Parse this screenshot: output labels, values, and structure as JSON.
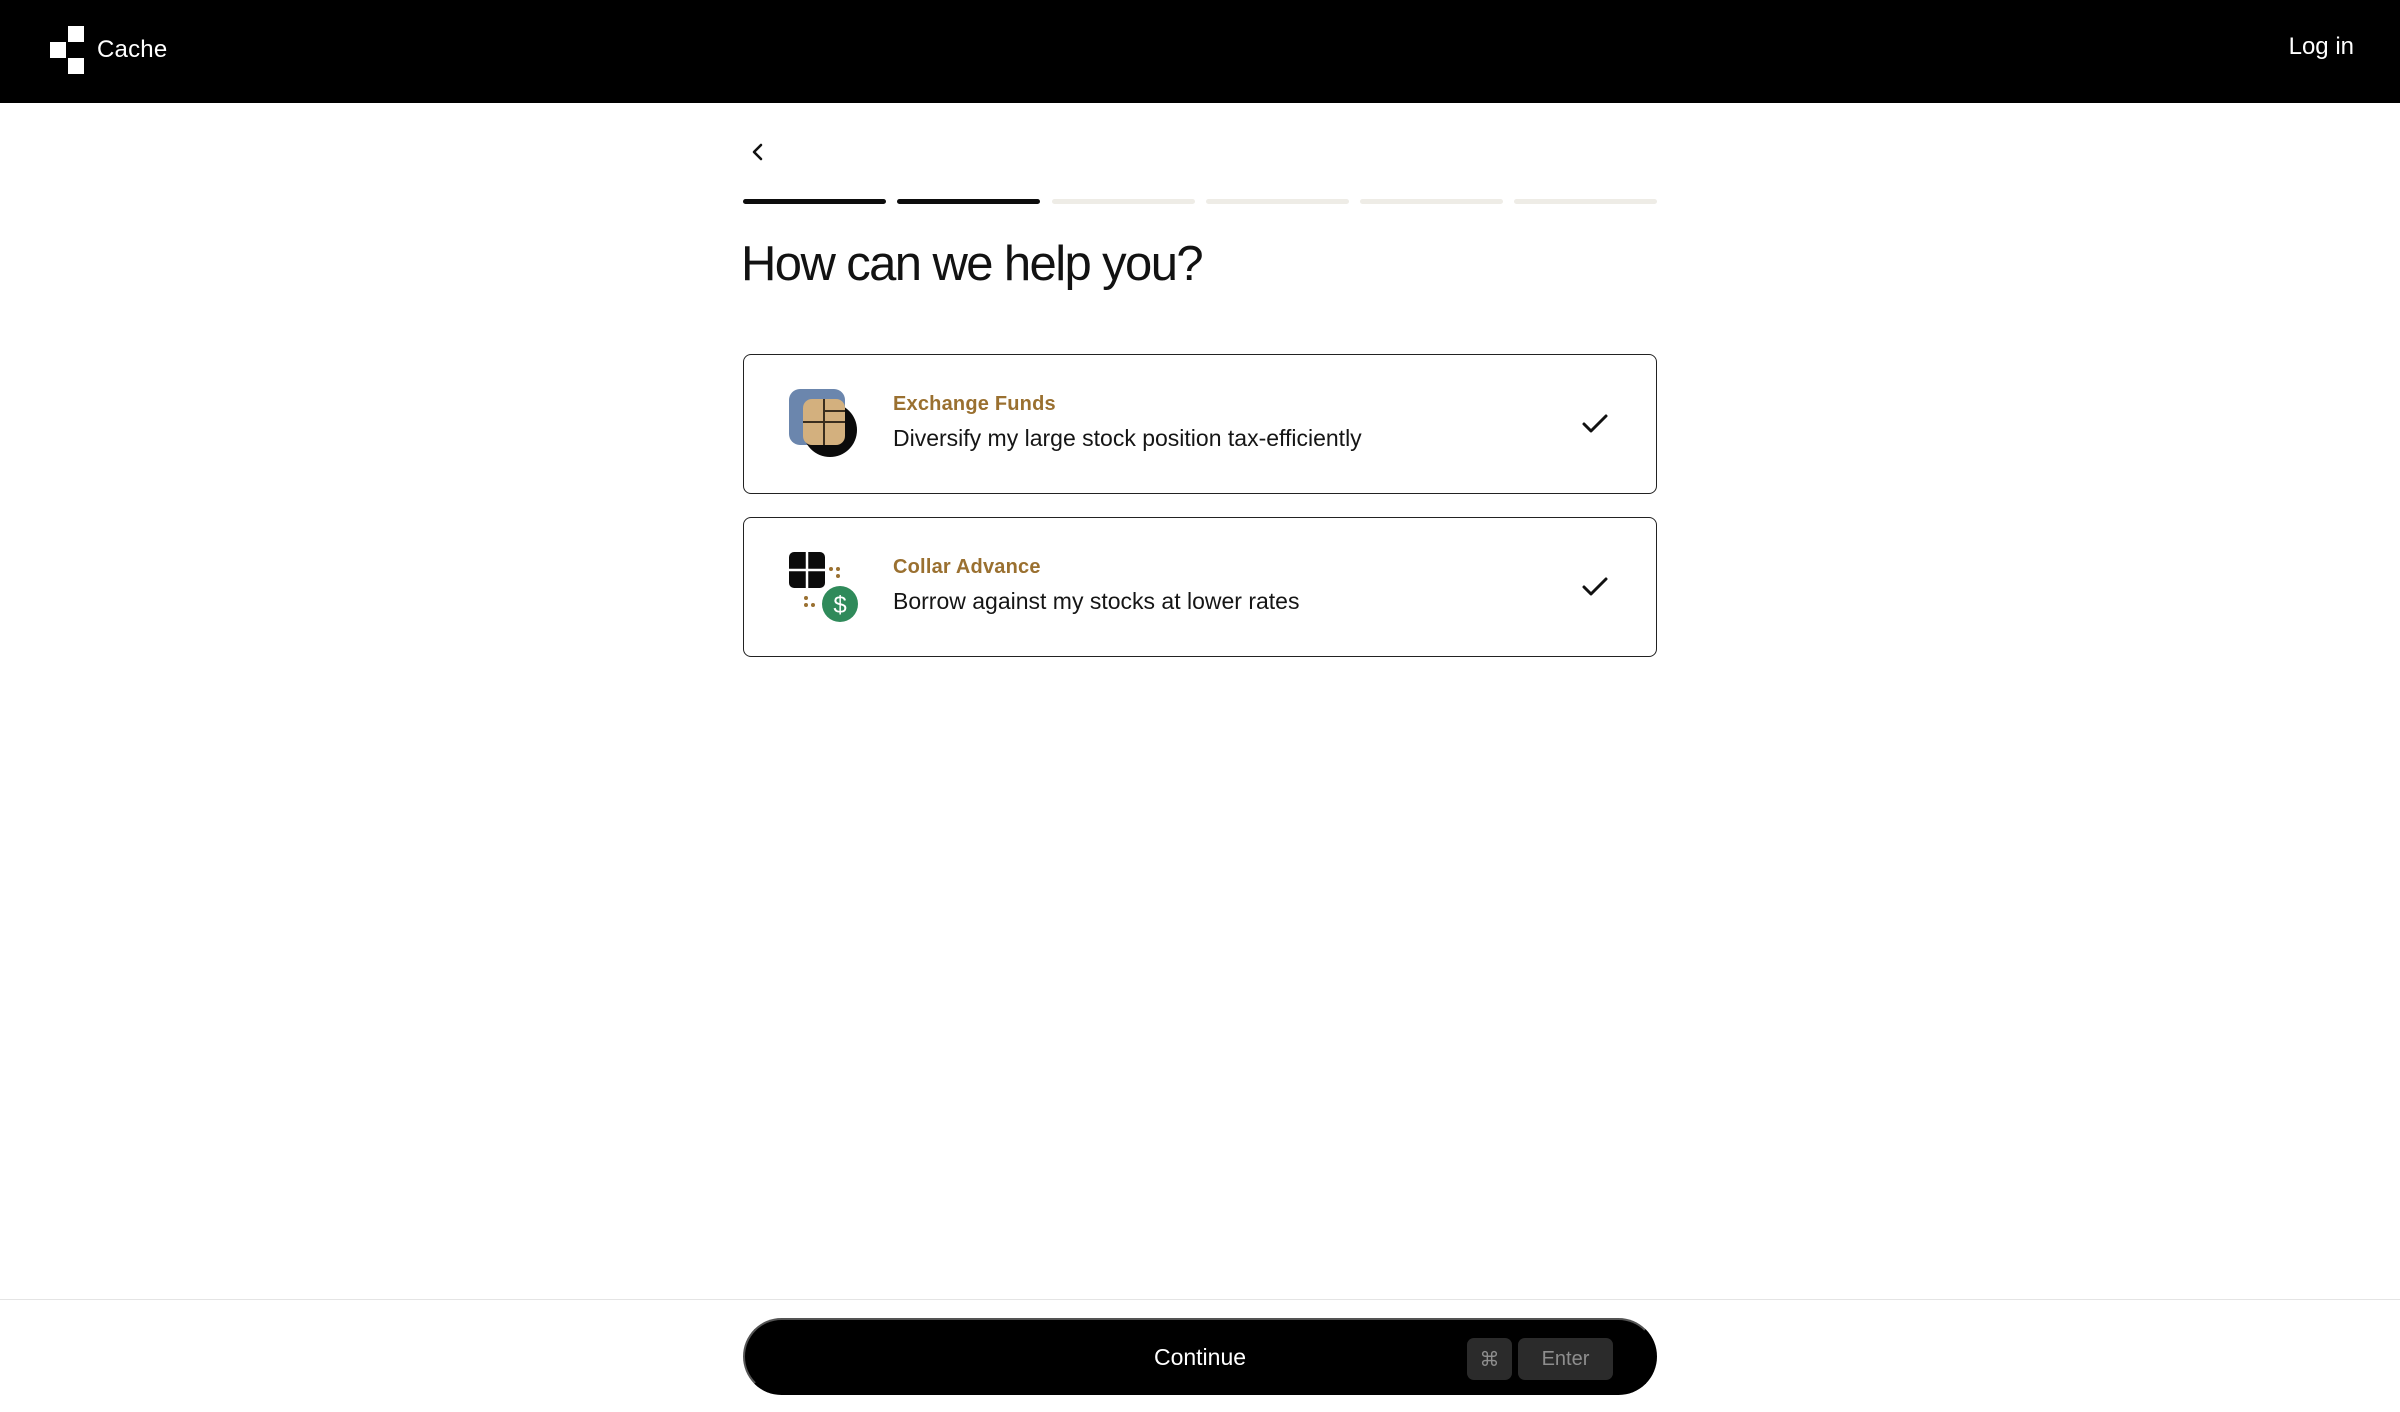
{
  "header": {
    "brand_name": "Cache",
    "logo_icon": "cache-logo-icon",
    "login_label": "Log in",
    "background": "#000000"
  },
  "navigation": {
    "back_icon": "chevron-left-icon"
  },
  "progress": {
    "total_steps": 6,
    "completed_steps": 2
  },
  "page": {
    "title": "How can we help you?"
  },
  "options": [
    {
      "subtitle": "Exchange Funds",
      "description": "Diversify my large stock position tax-efficiently",
      "icon": "exchange-funds-icon",
      "selected": true
    },
    {
      "subtitle": "Collar Advance",
      "description": "Borrow against my stocks at lower rates",
      "icon": "collar-advance-icon",
      "selected": true
    }
  ],
  "footer": {
    "continue_label": "Continue",
    "shortcut_modifier": "⌘",
    "shortcut_key": "Enter"
  },
  "colors": {
    "accent_gold": "#9a7030",
    "icon_blue": "#6b86ad",
    "icon_tan": "#d3b07e",
    "dollar_green": "#2f8a5a",
    "progress_done": "#0d0d0d",
    "progress_todo": "#eeece6"
  }
}
